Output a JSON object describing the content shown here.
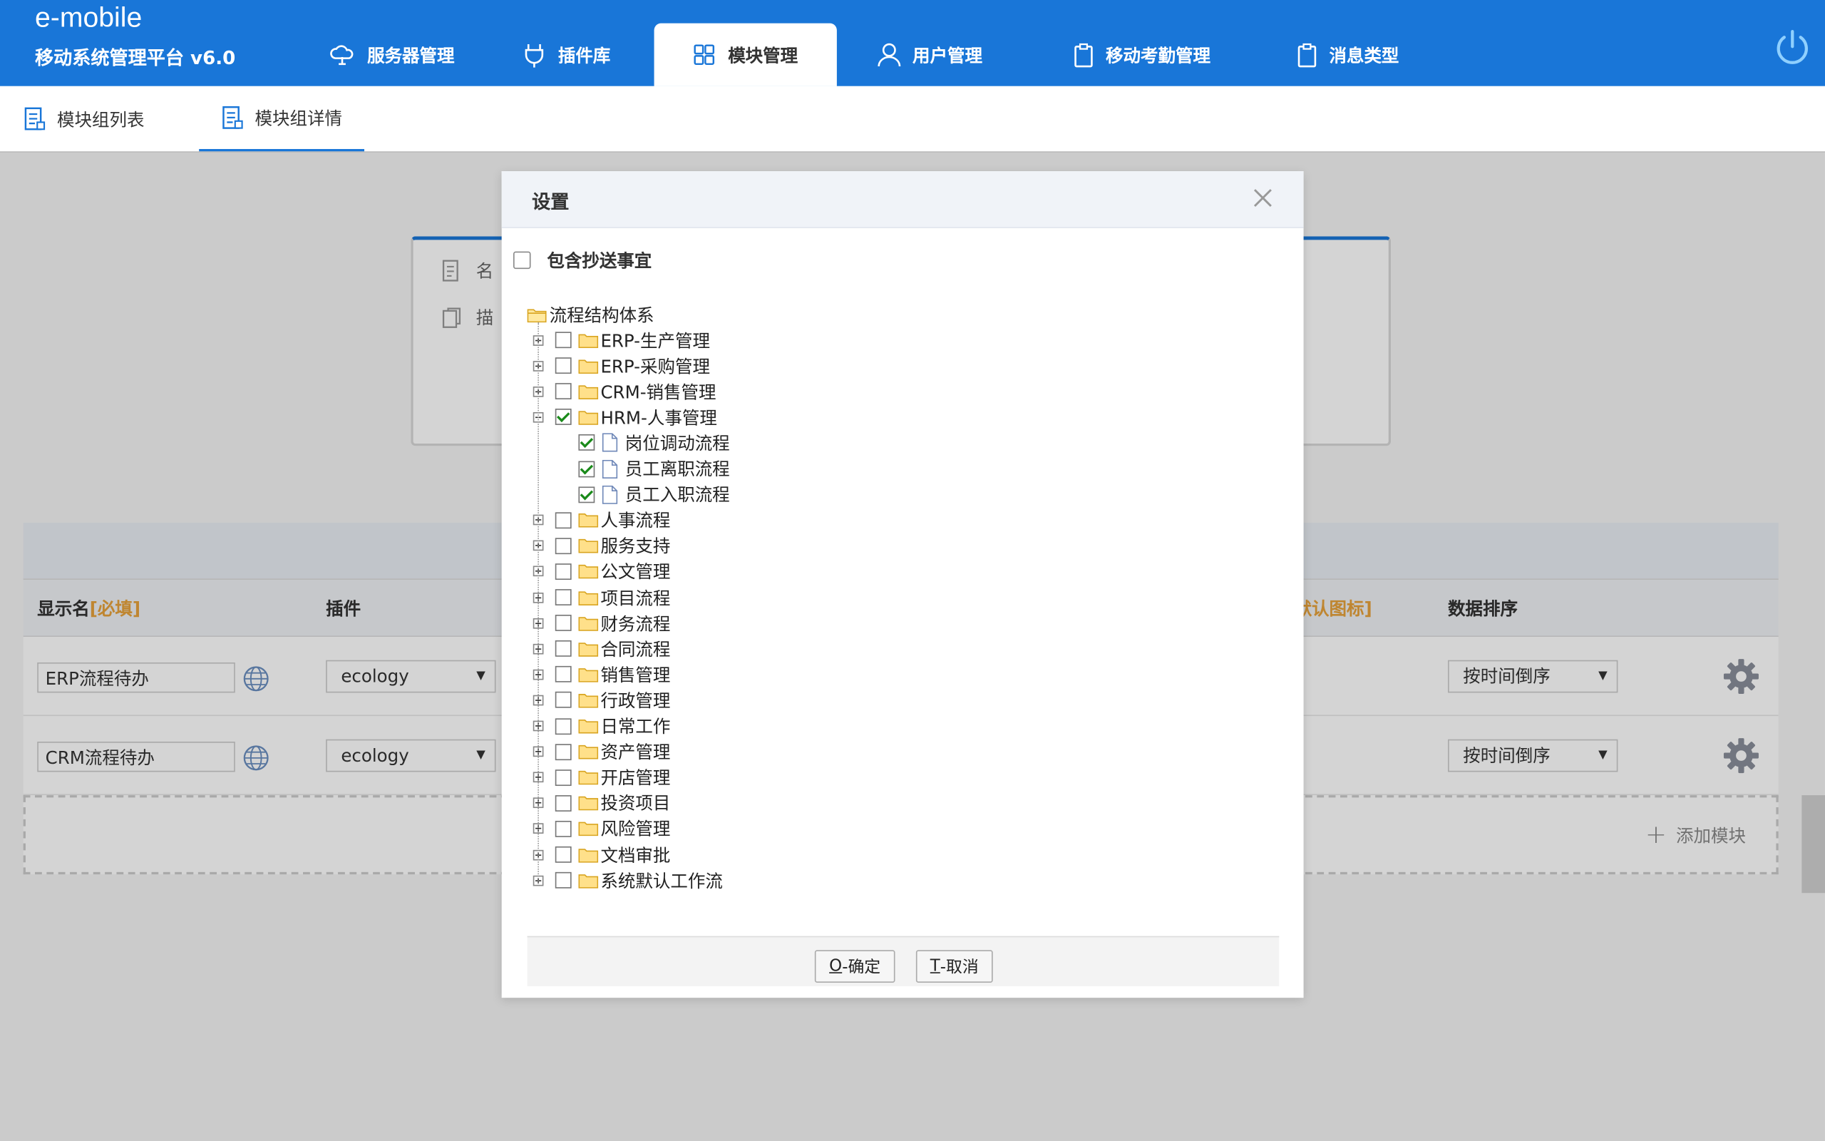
{
  "header": {
    "brand": "e-mobile",
    "subtitle": "移动系统管理平台 v6.0",
    "nav": [
      {
        "label": "服务器管理",
        "icon": "cloud-icon"
      },
      {
        "label": "插件库",
        "icon": "plug-icon"
      },
      {
        "label": "模块管理",
        "icon": "modules-icon",
        "active": true
      },
      {
        "label": "用户管理",
        "icon": "user-icon"
      },
      {
        "label": "移动考勤管理",
        "icon": "clipboard-icon"
      },
      {
        "label": "消息类型",
        "icon": "clipboard-icon"
      }
    ],
    "accent": "#1976d8"
  },
  "subtabs": [
    {
      "label": "模块组列表"
    },
    {
      "label": "模块组详情",
      "active": true
    }
  ],
  "info": {
    "name_label": "名",
    "desc_label": "描"
  },
  "table": {
    "col_name": "显示名",
    "col_name_required": "[必填]",
    "col_plugin": "插件",
    "col_icon_fragment": "默认图标]",
    "col_sort": "数据排序",
    "rows": [
      {
        "name": "ERP流程待办",
        "plugin": "ecology",
        "sort": "按时间倒序"
      },
      {
        "name": "CRM流程待办",
        "plugin": "ecology",
        "sort": "按时间倒序"
      }
    ],
    "add_label": "添加模块"
  },
  "dialog": {
    "title": "设置",
    "include_cc_label": "包含抄送事宜",
    "root": "流程结构体系",
    "nodes": [
      {
        "label": "ERP-生产管理",
        "checked": false,
        "expanded": false
      },
      {
        "label": "ERP-采购管理",
        "checked": false,
        "expanded": false
      },
      {
        "label": "CRM-销售管理",
        "checked": false,
        "expanded": false
      },
      {
        "label": "HRM-人事管理",
        "checked": true,
        "expanded": true,
        "children": [
          {
            "label": "岗位调动流程",
            "checked": true
          },
          {
            "label": "员工离职流程",
            "checked": true
          },
          {
            "label": "员工入职流程",
            "checked": true
          }
        ]
      },
      {
        "label": "人事流程",
        "checked": false,
        "expanded": false
      },
      {
        "label": "服务支持",
        "checked": false,
        "expanded": false
      },
      {
        "label": "公文管理",
        "checked": false,
        "expanded": false
      },
      {
        "label": "项目流程",
        "checked": false,
        "expanded": false
      },
      {
        "label": "财务流程",
        "checked": false,
        "expanded": false
      },
      {
        "label": "合同流程",
        "checked": false,
        "expanded": false
      },
      {
        "label": "销售管理",
        "checked": false,
        "expanded": false
      },
      {
        "label": "行政管理",
        "checked": false,
        "expanded": false
      },
      {
        "label": "日常工作",
        "checked": false,
        "expanded": false
      },
      {
        "label": "资产管理",
        "checked": false,
        "expanded": false
      },
      {
        "label": "开店管理",
        "checked": false,
        "expanded": false
      },
      {
        "label": "投资项目",
        "checked": false,
        "expanded": false
      },
      {
        "label": "风险管理",
        "checked": false,
        "expanded": false
      },
      {
        "label": "文档审批",
        "checked": false,
        "expanded": false
      },
      {
        "label": "系统默认工作流",
        "checked": false,
        "expanded": false
      }
    ],
    "ok_key": "O",
    "ok_label": "-确定",
    "cancel_key": "T",
    "cancel_label": "-取消"
  }
}
